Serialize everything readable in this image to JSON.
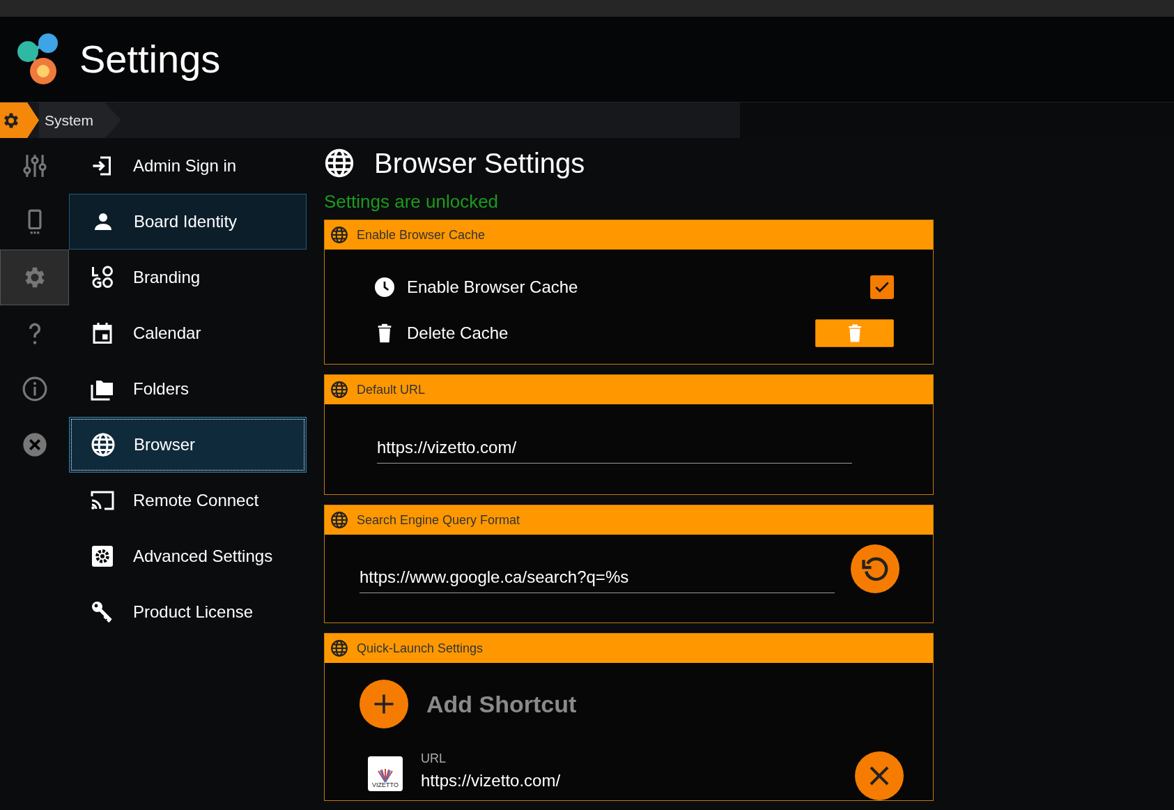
{
  "header": {
    "title": "Settings"
  },
  "breadcrumb": [
    {
      "label": "System"
    }
  ],
  "rail": [
    {
      "selected": false
    },
    {
      "selected": false
    },
    {
      "selected": true
    },
    {
      "selected": false
    },
    {
      "selected": false
    },
    {
      "selected": false
    }
  ],
  "nav": [
    {
      "label": "Admin Sign in",
      "selected": false,
      "hovered": false
    },
    {
      "label": "Board Identity",
      "selected": false,
      "hovered": true
    },
    {
      "label": "Branding",
      "selected": false,
      "hovered": false
    },
    {
      "label": "Calendar",
      "selected": false,
      "hovered": false
    },
    {
      "label": "Folders",
      "selected": false,
      "hovered": false
    },
    {
      "label": "Browser",
      "selected": true,
      "hovered": false
    },
    {
      "label": "Remote Connect",
      "selected": false,
      "hovered": false
    },
    {
      "label": "Advanced Settings",
      "selected": false,
      "hovered": false
    },
    {
      "label": "Product License",
      "selected": false,
      "hovered": false
    }
  ],
  "content": {
    "title": "Browser Settings",
    "status": "Settings are unlocked",
    "panels": [
      {
        "kind": "toggles",
        "title": "Enable Browser Cache",
        "rows": [
          {
            "kind": "checkbox",
            "label": "Enable Browser Cache",
            "checked": true
          },
          {
            "kind": "delete",
            "label": "Delete Cache"
          }
        ]
      },
      {
        "kind": "url",
        "title": "Default URL",
        "value": "https://vizetto.com/"
      },
      {
        "kind": "query",
        "title": "Search Engine Query Format",
        "value": "https://www.google.ca/search?q=%s"
      },
      {
        "kind": "shortcuts",
        "title": "Quick-Launch Settings",
        "add_label": "Add Shortcut",
        "shortcuts": [
          {
            "caption": "URL",
            "url": "https://vizetto.com/",
            "logo_text": "VIZETTO"
          }
        ]
      }
    ]
  }
}
